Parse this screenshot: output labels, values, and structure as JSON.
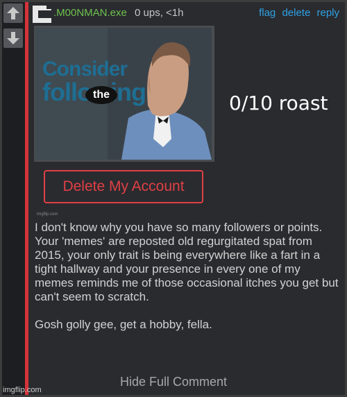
{
  "comment": {
    "username": ".M00NMAN.exe",
    "meta": "0 ups, <1h",
    "actions": [
      "flag",
      "delete",
      "reply"
    ],
    "body": "I don't know why you have so many followers or points. Your 'memes' are reposted old regurgitated spat from 2015, your only trait is being everywhere like a fart in a tight hallway and your presence in every one of my memes reminds me of those occasional itches you get but can't seem to scratch.\n\nGosh golly gee, get a hobby, fella.",
    "hide_link": "Hide Full Comment"
  },
  "meme": {
    "line1": "Consider",
    "bubble": "the",
    "line2": "following",
    "button": "Delete My Account",
    "credit": "imgflip.com"
  },
  "overlay_text": "0/10 roast",
  "watermark": "imgflip.com",
  "icons": {
    "upvote": "arrow-up-icon",
    "downvote": "arrow-down-icon",
    "avatar": "user-avatar-icon"
  },
  "colors": {
    "username": "#6ec24e",
    "action_links": "#2ea1e4",
    "accent_rule": "#d6333a",
    "delete_button": "#e04045"
  }
}
